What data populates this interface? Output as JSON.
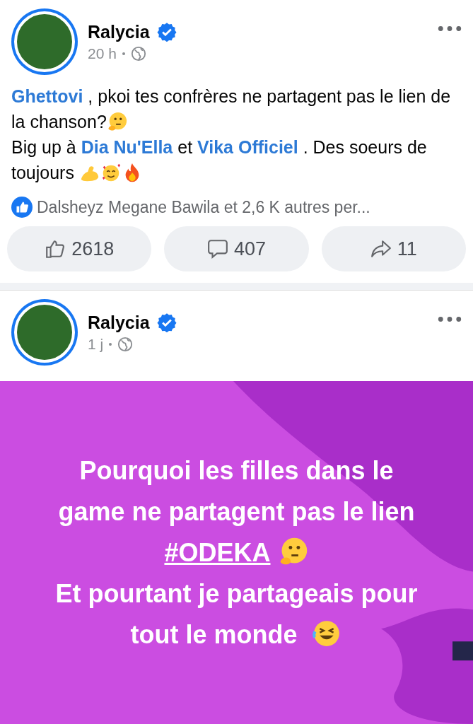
{
  "posts": [
    {
      "author": "Ralycia",
      "verified": true,
      "time": "20 h",
      "text": [
        {
          "kind": "mention",
          "text": "Ghettovi"
        },
        {
          "kind": "text",
          "text": " , pkoi tes confrères ne partagent pas le lien de la chanson?"
        },
        {
          "kind": "thinking"
        },
        {
          "kind": "break"
        },
        {
          "kind": "text",
          "text": "Big up à "
        },
        {
          "kind": "mention",
          "text": "Dia Nu'Ella"
        },
        {
          "kind": "text",
          "text": " et "
        },
        {
          "kind": "mention",
          "text": "Vika Officiel"
        },
        {
          "kind": "text",
          "text": " . Des soeurs de toujours "
        },
        {
          "kind": "biceps"
        },
        {
          "kind": "hearts"
        },
        {
          "kind": "fire"
        }
      ],
      "reactions": "Dalsheyz Megane Bawila et 2,6 K autres per...",
      "actions": [
        {
          "kind": "like",
          "count": "2618"
        },
        {
          "kind": "comment",
          "count": "407"
        },
        {
          "kind": "share",
          "count": "11"
        }
      ]
    },
    {
      "author": "Ralycia",
      "verified": true,
      "time": "1 j",
      "background_text": [
        {
          "kind": "text",
          "text": "Pourquoi les filles dans le"
        },
        {
          "kind": "break"
        },
        {
          "kind": "text",
          "text": "game ne partagent pas le lien"
        },
        {
          "kind": "break"
        },
        {
          "kind": "hashtag",
          "text": "#ODEKA"
        },
        {
          "kind": "thinking"
        },
        {
          "kind": "break"
        },
        {
          "kind": "text",
          "text": "Et pourtant je partageais pour"
        },
        {
          "kind": "break"
        },
        {
          "kind": "text",
          "text": "tout le monde "
        },
        {
          "kind": "rofl"
        }
      ]
    }
  ]
}
